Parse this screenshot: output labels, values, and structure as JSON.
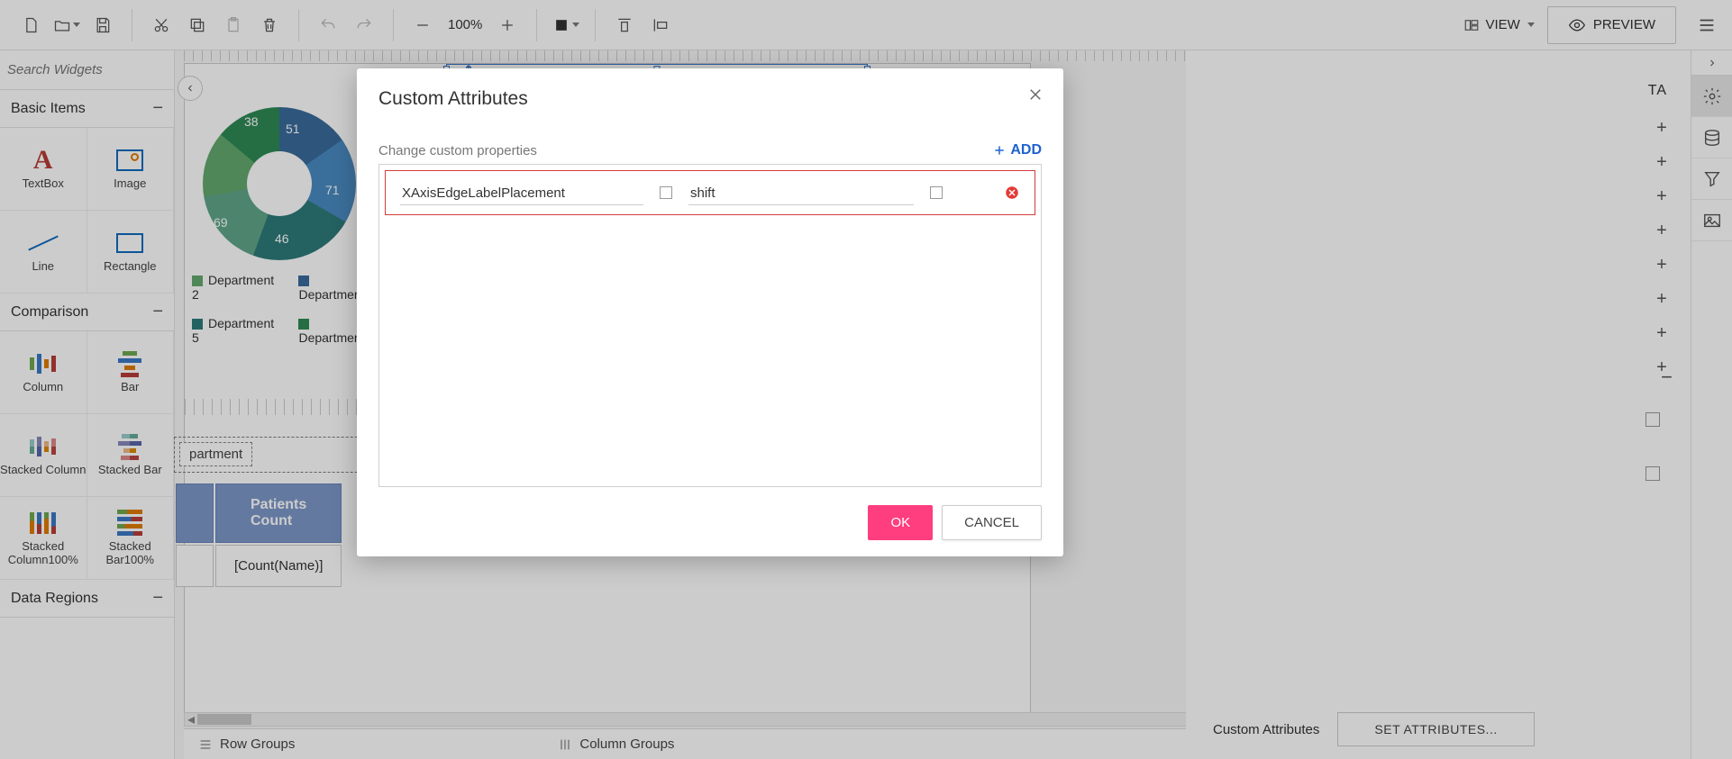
{
  "toolbar": {
    "zoom": "100%",
    "view_label": "VIEW",
    "preview_label": "PREVIEW"
  },
  "sidebar": {
    "search_placeholder": "Search Widgets",
    "sections": {
      "basic": {
        "title": "Basic Items"
      },
      "comparison": {
        "title": "Comparison"
      },
      "data_regions": {
        "title": "Data Regions"
      }
    },
    "widgets": {
      "textbox": "TextBox",
      "image": "Image",
      "line": "Line",
      "rectangle": "Rectangle",
      "column": "Column",
      "bar": "Bar",
      "stacked_column": "Stacked Column",
      "stacked_bar": "Stacked Bar",
      "stacked_column_100": "Stacked Column100%",
      "stacked_bar_100": "Stacked Bar100%"
    }
  },
  "chart_data": {
    "type": "pie",
    "title": "",
    "slices": [
      {
        "label": "46",
        "value": 46,
        "color": "#3a6b9c"
      },
      {
        "label": "69",
        "value": 69,
        "color": "#2d7a7a"
      },
      {
        "label": "38",
        "value": 38,
        "color": "#5fa68a"
      },
      {
        "label": "51",
        "value": 51,
        "color": "#2f8a55"
      },
      {
        "label": "71",
        "value": 71,
        "color": "#4a8bc2"
      }
    ],
    "legend": [
      {
        "name": "Department 2",
        "color": "#63a96e"
      },
      {
        "name": "Departmen",
        "color": "#3a6b9c"
      },
      {
        "name": "Department 5",
        "color": "#2d7a7a"
      },
      {
        "name": "Departmen",
        "color": "#2f8a55"
      }
    ]
  },
  "tablix": {
    "field_tag": "partment",
    "header": "Patients Count",
    "cell": "[Count(Name)]"
  },
  "groups_bar": {
    "row": "Row Groups",
    "col": "Column Groups"
  },
  "right_panel": {
    "tab": "TA",
    "custom_attributes_label": "Custom Attributes",
    "set_button": "SET ATTRIBUTES..."
  },
  "modal": {
    "title": "Custom Attributes",
    "subtitle": "Change custom properties",
    "add_label": "ADD",
    "row": {
      "key": "XAxisEdgeLabelPlacement",
      "value": "shift"
    },
    "ok": "OK",
    "cancel": "CANCEL"
  }
}
